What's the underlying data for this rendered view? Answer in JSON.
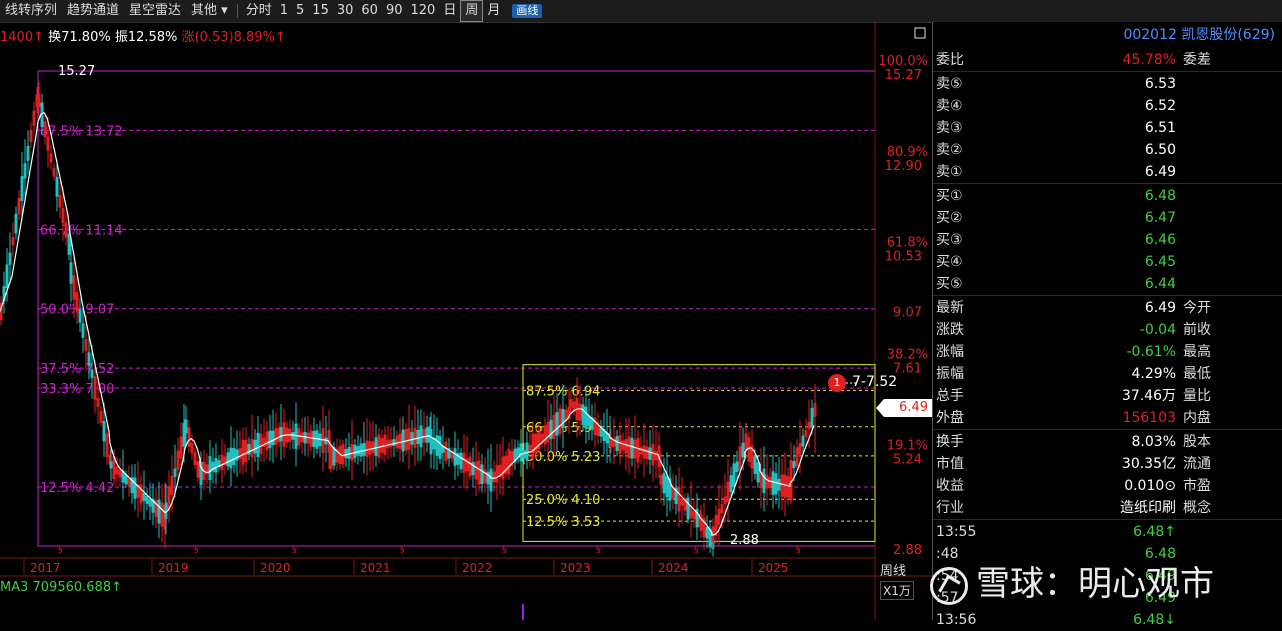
{
  "toolbar": {
    "items": [
      "线转序列",
      "趋势通道",
      "星空雷达",
      "其他 ▾"
    ],
    "periods": [
      "分时",
      "1",
      "5",
      "15",
      "30",
      "60",
      "90",
      "120",
      "日",
      "周",
      "月"
    ],
    "active_period": "周",
    "draw_label": "画线"
  },
  "info": {
    "prefix": "1400↑",
    "turnover": "换71.80%",
    "amplitude": "振12.58%",
    "change": "涨(0.53)8.89%↑"
  },
  "colors": {
    "up": "#e02020",
    "down": "#20c0c0",
    "fib": "#d020d0",
    "yellow": "#e8e830",
    "green": "#3fd03f",
    "purple": "#a020e0"
  },
  "chart_data": {
    "type": "candlestick",
    "high_mark": "15.27",
    "low_mark": "2.88",
    "fib_levels": [
      {
        "label": "87.5% 13.72",
        "value": 13.72
      },
      {
        "label": "66.7% 11.14",
        "value": 11.14
      },
      {
        "label": "50.0% 9.07",
        "value": 9.07
      },
      {
        "label": "37.5% 7.52",
        "value": 7.52
      },
      {
        "label": "33.3% 7.00",
        "value": 7.0
      },
      {
        "label": "12.5% 4.42",
        "value": 4.42
      }
    ],
    "fib2_levels": [
      {
        "label": "87.5% 6.94",
        "value": 6.94
      },
      {
        "label": "66.7% 5.99",
        "value": 5.99
      },
      {
        "label": "50.0% 5.23",
        "value": 5.23
      },
      {
        "label": "25.0% 4.10",
        "value": 4.1
      },
      {
        "label": "12.5% 3.53",
        "value": 3.53
      }
    ],
    "axis_labels": [
      {
        "pct": "100.0%",
        "price": "15.27",
        "value": 15.27
      },
      {
        "pct": "80.9%",
        "price": "12.90",
        "value": 12.9
      },
      {
        "pct": "61.8%",
        "price": "10.53",
        "value": 10.53
      },
      {
        "pct": "",
        "price": "9.07",
        "value": 9.07
      },
      {
        "pct": "38.2%",
        "price": "7.61",
        "value": 7.61
      },
      {
        "pct": "19.1%",
        "price": "5.24",
        "value": 5.24
      },
      {
        "pct": "",
        "price": "2.88",
        "value": 2.88
      }
    ],
    "years": [
      "2017",
      "2019",
      "2020",
      "2021",
      "2022",
      "2023",
      "2024",
      "2025"
    ],
    "current_price": "6.49",
    "annotation": "7-7.52",
    "annotation_num": "1",
    "period_label": "周线",
    "volume_unit": "X1万",
    "ma3": "MA3 709560.688↑"
  },
  "panel": {
    "code": "002012 凯恩股份(629)",
    "weibi_label": "委比",
    "weibi_value": "45.78%",
    "weicha_label": "委差",
    "sells": [
      {
        "label": "卖⑤",
        "value": "6.53"
      },
      {
        "label": "卖④",
        "value": "6.52"
      },
      {
        "label": "卖③",
        "value": "6.51"
      },
      {
        "label": "卖②",
        "value": "6.50"
      },
      {
        "label": "卖①",
        "value": "6.49"
      }
    ],
    "buys": [
      {
        "label": "买①",
        "value": "6.48"
      },
      {
        "label": "买②",
        "value": "6.47"
      },
      {
        "label": "买③",
        "value": "6.46"
      },
      {
        "label": "买④",
        "value": "6.45"
      },
      {
        "label": "买⑤",
        "value": "6.44"
      }
    ],
    "stats": [
      {
        "label": "最新",
        "value": "6.49",
        "label2": "今开",
        "color": "#fff"
      },
      {
        "label": "涨跌",
        "value": "-0.04",
        "label2": "前收",
        "color": "#3fd03f"
      },
      {
        "label": "涨幅",
        "value": "-0.61%",
        "label2": "最高",
        "color": "#3fd03f"
      },
      {
        "label": "振幅",
        "value": "4.29%",
        "label2": "最低",
        "color": "#fff"
      },
      {
        "label": "总手",
        "value": "37.46万",
        "label2": "量比",
        "color": "#fff"
      },
      {
        "label": "外盘",
        "value": "156103",
        "label2": "内盘",
        "color": "#e02020"
      }
    ],
    "stats2": [
      {
        "label": "换手",
        "value": "8.03%",
        "label2": "股本",
        "color": "#fff"
      },
      {
        "label": "市值",
        "value": "30.35亿",
        "label2": "流通",
        "color": "#fff"
      },
      {
        "label": "收益",
        "value": "0.010⊙",
        "label2": "市盈",
        "color": "#fff"
      },
      {
        "label": "行业",
        "value": "造纸印刷",
        "label2": "概念",
        "color": "#fff"
      }
    ],
    "ticks": [
      {
        "time": "13:55",
        "price": "6.48↑"
      },
      {
        "time": ":48",
        "price": "6.48"
      },
      {
        "time": ":54",
        "price": "6.49"
      },
      {
        "time": ":57",
        "price": "6.49"
      },
      {
        "time": "13:56",
        "price": "6.48↓"
      }
    ]
  },
  "watermark": "雪球：明心观市"
}
